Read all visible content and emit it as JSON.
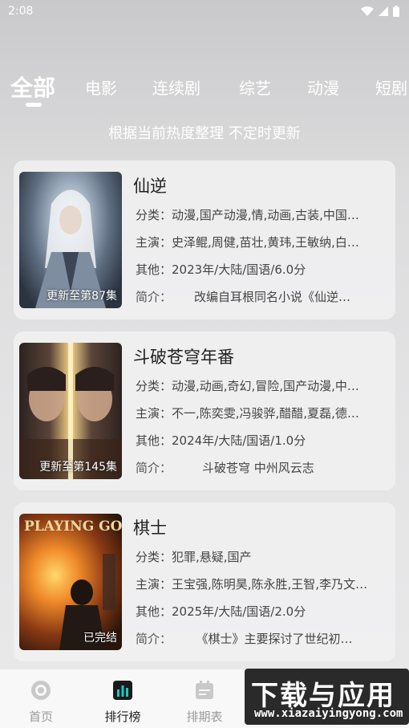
{
  "status_bar": {
    "time": "2:08"
  },
  "tabs": [
    {
      "label": "全部"
    },
    {
      "label": "电影"
    },
    {
      "label": "连续剧"
    },
    {
      "label": "综艺"
    },
    {
      "label": "动漫"
    },
    {
      "label": "短剧"
    }
  ],
  "subtitle": "根据当前热度整理 不定时更新",
  "cards": [
    {
      "title": "仙逆",
      "badge": "更新至第87集",
      "category": "分类：动漫,国产动漫,情,动画,古装,中国…",
      "cast": "主演：史泽鲲,周健,苗壮,黄玮,王敏纳,白…",
      "other": "其他：2023年/大陆/国语/6.0分",
      "intro_label": "简介：",
      "intro": "改编自耳根同名小说《仙逆…"
    },
    {
      "title": "斗破苍穹年番",
      "badge": "更新至第145集",
      "category": "分类：动漫,动画,奇幻,冒险,国产动漫,中…",
      "cast": "主演：不一,陈奕雯,冯骏骅,醋醋,夏磊,德…",
      "other": "其他：2024年/大陆/国语/1.0分",
      "intro_label": "简介：",
      "intro": "斗破苍穹 中州风云志"
    },
    {
      "title": "棋士",
      "badge": "已完结",
      "poster_text": "PLAYING GO",
      "category": "分类：犯罪,悬疑,国产",
      "cast": "主演：王宝强,陈明昊,陈永胜,王智,李乃文…",
      "other": "其他：2025年/大陆/国语/2.0分",
      "intro_label": "简介：",
      "intro": "《棋士》主要探讨了世纪初…"
    }
  ],
  "bottom_nav": [
    {
      "label": "首页",
      "icon": "home-icon"
    },
    {
      "label": "排行榜",
      "icon": "ranking-icon"
    },
    {
      "label": "排期表",
      "icon": "schedule-icon"
    }
  ],
  "watermark": {
    "main": "下载与应用",
    "sub": "www.xiazaiyingyong.com"
  },
  "colors": {
    "accent": "#1fc7c0",
    "nav_inactive": "#9a9a9a"
  }
}
